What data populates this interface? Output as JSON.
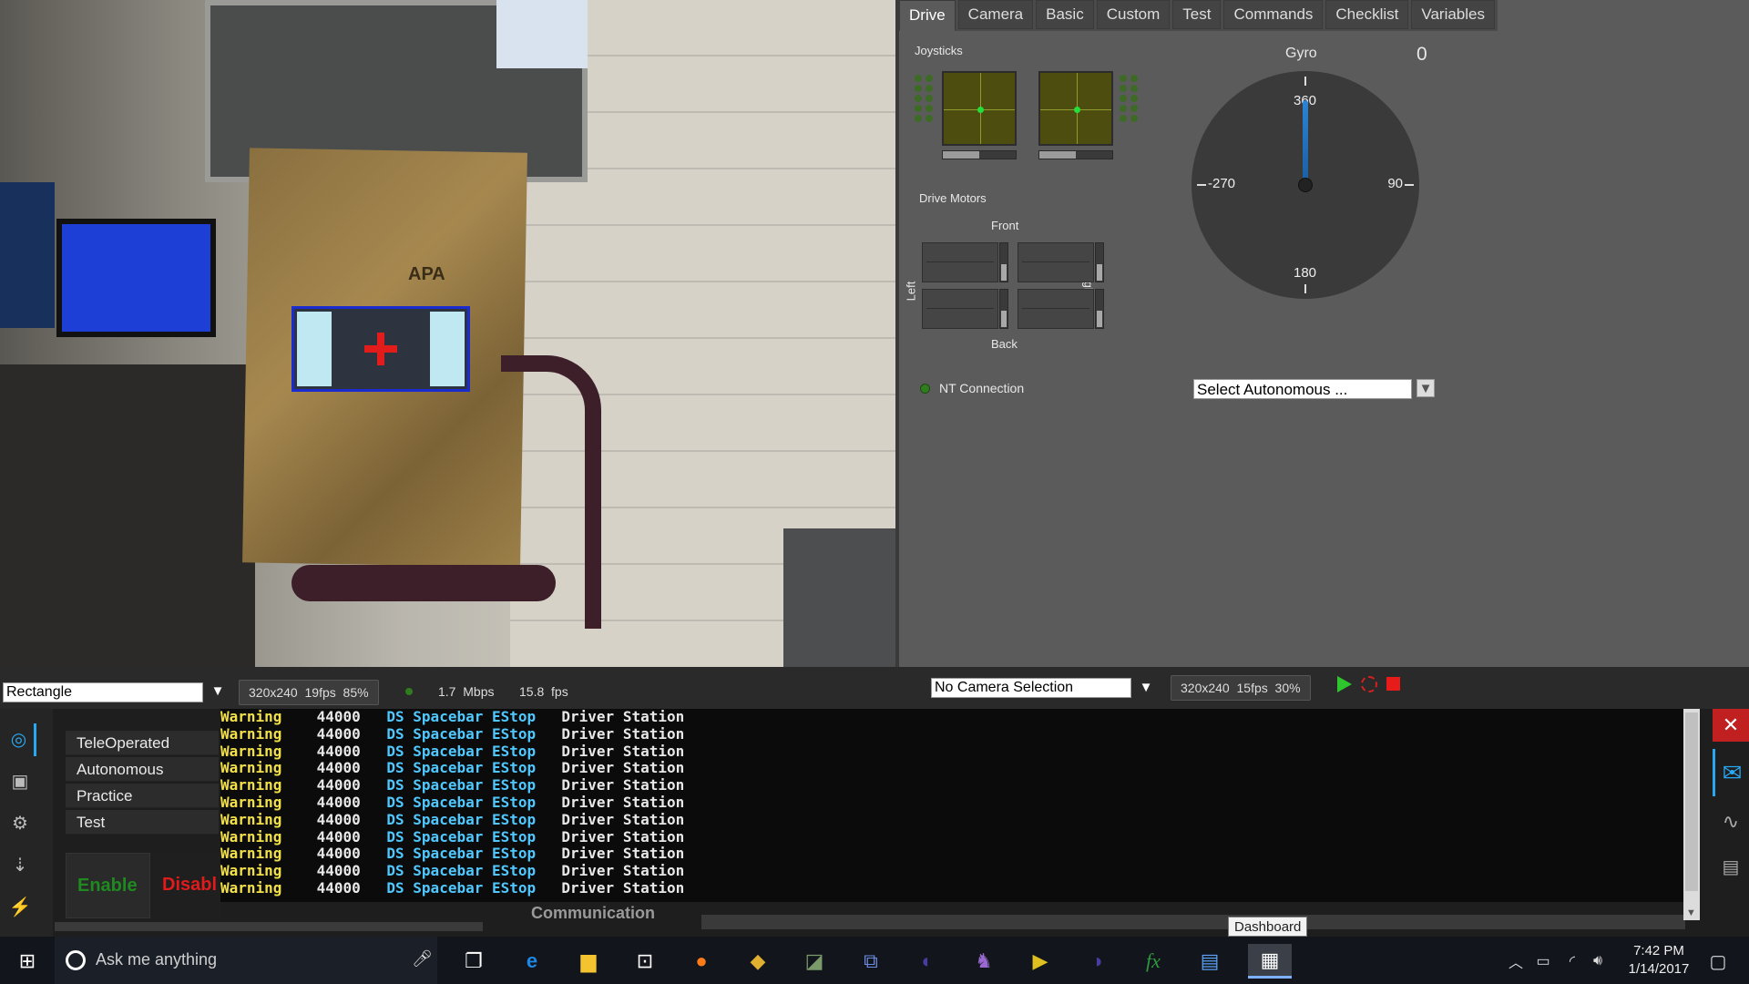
{
  "camera": {
    "processing_select": "Rectangle",
    "stats": {
      "resolution": "320x240",
      "fps": "19fps",
      "quality": "85%",
      "bandwidth": "1.7",
      "bandwidth_unit": "Mbps",
      "rate": "15.8",
      "rate_unit": "fps"
    },
    "board_text": "APA"
  },
  "dashboard": {
    "tabs": [
      "Drive",
      "Camera",
      "Basic",
      "Custom",
      "Test",
      "Commands",
      "Checklist",
      "Variables"
    ],
    "active_tab": "Drive",
    "joysticks_label": "Joysticks",
    "drive_motors_label": "Drive Motors",
    "front_label": "Front",
    "back_label": "Back",
    "left_label": "Left",
    "right_label": "Right",
    "nt_connection_label": "NT Connection",
    "gyro": {
      "label": "Gyro",
      "value": "0",
      "ticks": {
        "top": "360",
        "right": "90",
        "bottom": "180",
        "left": "-270"
      }
    },
    "autonomous_select": "Select Autonomous ..."
  },
  "camera2": {
    "selection": "No Camera Selection",
    "resolution": "320x240",
    "fps": "15fps",
    "quality": "30%"
  },
  "driver_station": {
    "modes": [
      "TeleOperated",
      "Autonomous",
      "Practice",
      "Test"
    ],
    "enable_label": "Enable",
    "disable_label": "Disabl",
    "communication_label": "Communication",
    "messages": [
      {
        "level": "Warning",
        "code": "44000",
        "text": "DS Spacebar EStop",
        "source": "Driver Station"
      },
      {
        "level": "Warning",
        "code": "44000",
        "text": "DS Spacebar EStop",
        "source": "Driver Station"
      },
      {
        "level": "Warning",
        "code": "44000",
        "text": "DS Spacebar EStop",
        "source": "Driver Station"
      },
      {
        "level": "Warning",
        "code": "44000",
        "text": "DS Spacebar EStop",
        "source": "Driver Station"
      },
      {
        "level": "Warning",
        "code": "44000",
        "text": "DS Spacebar EStop",
        "source": "Driver Station"
      },
      {
        "level": "Warning",
        "code": "44000",
        "text": "DS Spacebar EStop",
        "source": "Driver Station"
      },
      {
        "level": "Warning",
        "code": "44000",
        "text": "DS Spacebar EStop",
        "source": "Driver Station"
      },
      {
        "level": "Warning",
        "code": "44000",
        "text": "DS Spacebar EStop",
        "source": "Driver Station"
      },
      {
        "level": "Warning",
        "code": "44000",
        "text": "DS Spacebar EStop",
        "source": "Driver Station"
      },
      {
        "level": "Warning",
        "code": "44000",
        "text": "DS Spacebar EStop",
        "source": "Driver Station"
      },
      {
        "level": "Warning",
        "code": "44000",
        "text": "DS Spacebar EStop",
        "source": "Driver Station"
      }
    ],
    "tooltip": "Dashboard"
  },
  "taskbar": {
    "search_placeholder": "Ask me anything",
    "time": "7:42 PM",
    "date": "1/14/2017"
  },
  "colors": {
    "warning": "#f2e04a",
    "info": "#4fc8ff",
    "enable": "#1f7a1f",
    "disable": "#e01b1b",
    "accent": "#1e90ff"
  }
}
